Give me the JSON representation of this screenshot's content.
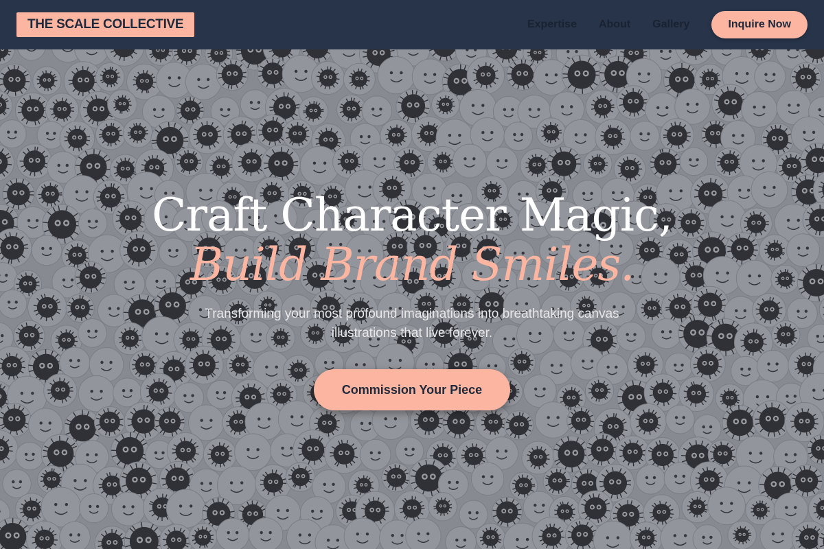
{
  "brand": {
    "logo_text": "THE SCALE COLLECTIVE"
  },
  "nav": {
    "links": [
      "Expertise",
      "About",
      "Gallery"
    ],
    "cta_label": "Inquire Now"
  },
  "hero": {
    "headline_line1": "Craft Character Magic,",
    "headline_line2": "Build Brand Smiles.",
    "subtitle": "Transforming your most profound imaginations into breathtaking canvas illustrations that live forever.",
    "button_label": "Commission Your Piece",
    "background_image": "doodle-pattern"
  },
  "colors": {
    "navbar_bg": "#27344a",
    "accent": "#fbb5a1",
    "text_dark": "#1e2a3b",
    "headline": "#ffffff"
  }
}
